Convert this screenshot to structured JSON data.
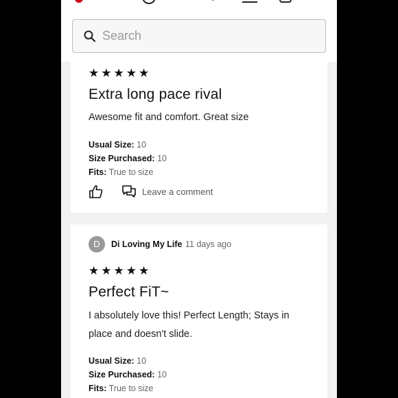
{
  "search": {
    "placeholder": "Search"
  },
  "reviews": [
    {
      "rating": 5,
      "title": "Extra long pace rival",
      "body": "Awesome fit and comfort. Great size",
      "usual_size_label": "Usual Size:",
      "usual_size": "10",
      "size_purchased_label": "Size Purchased:",
      "size_purchased": "10",
      "fits_label": "Fits:",
      "fits": "True to size",
      "comment_label": "Leave a comment"
    },
    {
      "avatar_letter": "D",
      "author": "Di Loving My Life",
      "time": "11 days ago",
      "rating": 5,
      "title": "Perfect FiT~",
      "body": "I absolutely love this! Perfect Length; Stays in place and doesn't slide.",
      "usual_size_label": "Usual Size:",
      "usual_size": "10",
      "size_purchased_label": "Size Purchased:",
      "size_purchased": "10",
      "fits_label": "Fits:",
      "fits": "True to size"
    }
  ],
  "colors": {
    "brand_red": "#d0021b",
    "background": "#f2f2f2",
    "avatar": "#999999"
  }
}
